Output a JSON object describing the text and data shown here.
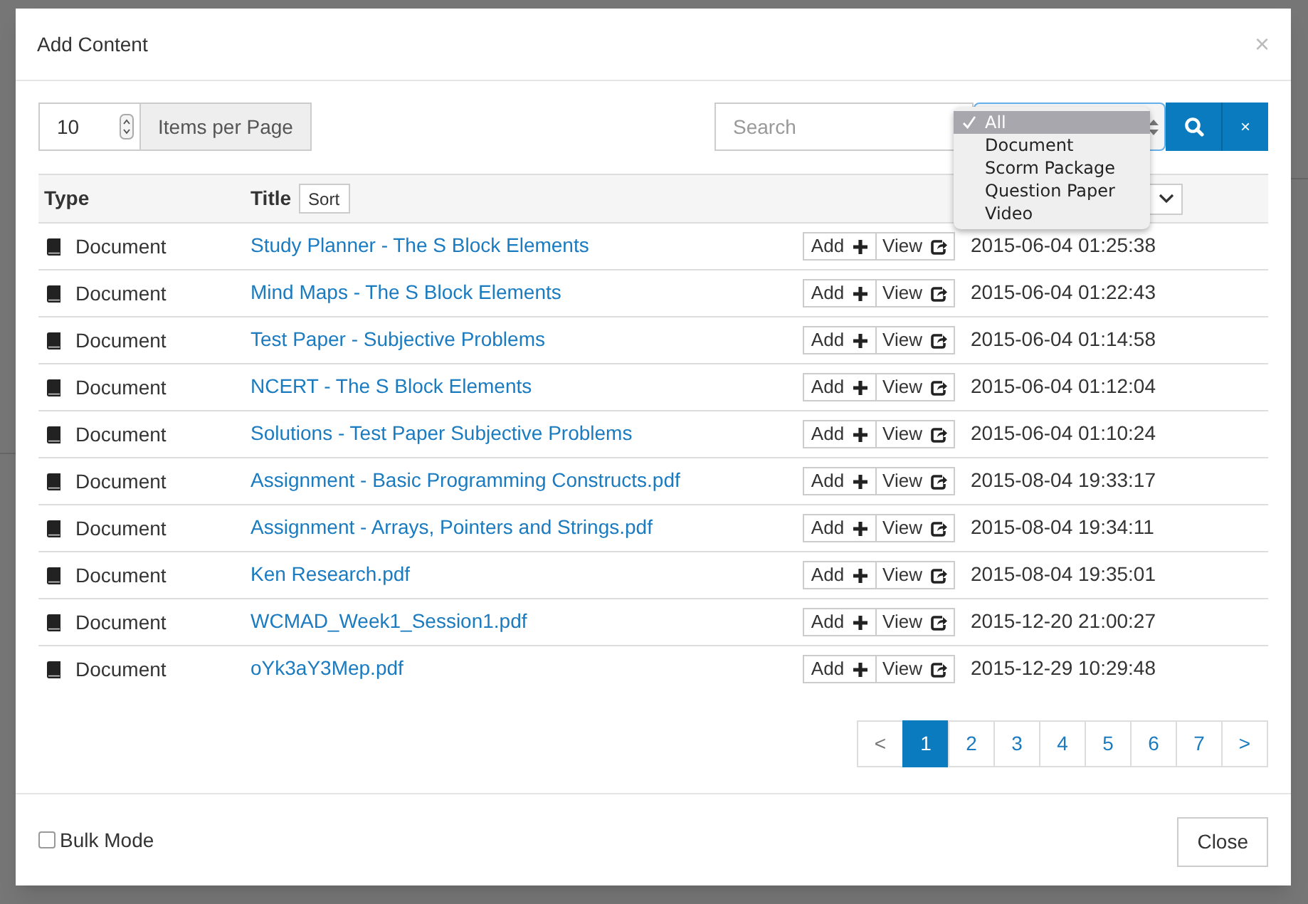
{
  "dialog": {
    "title": "Add Content",
    "close": "×"
  },
  "per_page": {
    "value": "10",
    "label": "Items per Page"
  },
  "search": {
    "placeholder": "Search"
  },
  "type_filter": {
    "options": [
      {
        "label": "All",
        "selected": true
      },
      {
        "label": "Document",
        "selected": false
      },
      {
        "label": "Scorm Package",
        "selected": false
      },
      {
        "label": "Question Paper",
        "selected": false
      },
      {
        "label": "Video",
        "selected": false
      }
    ]
  },
  "clear_button": "×",
  "table": {
    "columns": [
      "Type",
      "Title"
    ],
    "sort_button": "Sort",
    "rows": [
      {
        "type": "Document",
        "title": "Study Planner - The S Block Elements",
        "add": "Add",
        "view": "View",
        "date": "2015-06-04 01:25:38"
      },
      {
        "type": "Document",
        "title": "Mind Maps - The S Block Elements",
        "add": "Add",
        "view": "View",
        "date": "2015-06-04 01:22:43"
      },
      {
        "type": "Document",
        "title": "Test Paper - Subjective Problems",
        "add": "Add",
        "view": "View",
        "date": "2015-06-04 01:14:58"
      },
      {
        "type": "Document",
        "title": "NCERT - The S Block Elements",
        "add": "Add",
        "view": "View",
        "date": "2015-06-04 01:12:04"
      },
      {
        "type": "Document",
        "title": "Solutions - Test Paper Subjective Problems",
        "add": "Add",
        "view": "View",
        "date": "2015-06-04 01:10:24"
      },
      {
        "type": "Document",
        "title": "Assignment - Basic Programming Constructs.pdf",
        "add": "Add",
        "view": "View",
        "date": "2015-08-04 19:33:17"
      },
      {
        "type": "Document",
        "title": "Assignment - Arrays, Pointers and Strings.pdf",
        "add": "Add",
        "view": "View",
        "date": "2015-08-04 19:34:11"
      },
      {
        "type": "Document",
        "title": "Ken Research.pdf",
        "add": "Add",
        "view": "View",
        "date": "2015-08-04 19:35:01"
      },
      {
        "type": "Document",
        "title": "WCMAD_Week1_Session1.pdf",
        "add": "Add",
        "view": "View",
        "date": "2015-12-20 21:00:27"
      },
      {
        "type": "Document",
        "title": "oYk3aY3Mep.pdf",
        "add": "Add",
        "view": "View",
        "date": "2015-12-29 10:29:48"
      }
    ]
  },
  "pagination": {
    "prev": "<",
    "next": ">",
    "pages": [
      {
        "label": "1",
        "selected": true
      },
      {
        "label": "2",
        "selected": false
      },
      {
        "label": "3",
        "selected": false
      },
      {
        "label": "4",
        "selected": false
      },
      {
        "label": "5",
        "selected": false
      },
      {
        "label": "6",
        "selected": false
      },
      {
        "label": "7",
        "selected": false
      }
    ]
  },
  "bulk_mode": {
    "label": "Bulk Mode",
    "checked": false
  },
  "close_button": "Close"
}
